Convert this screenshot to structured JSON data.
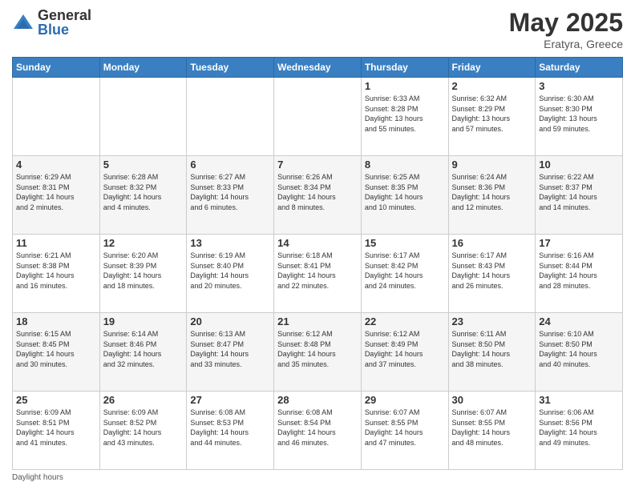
{
  "header": {
    "logo_general": "General",
    "logo_blue": "Blue",
    "month_title": "May 2025",
    "location": "Eratyra, Greece"
  },
  "footer": {
    "daylight_label": "Daylight hours"
  },
  "days_of_week": [
    "Sunday",
    "Monday",
    "Tuesday",
    "Wednesday",
    "Thursday",
    "Friday",
    "Saturday"
  ],
  "weeks": [
    [
      {
        "day": "",
        "info": ""
      },
      {
        "day": "",
        "info": ""
      },
      {
        "day": "",
        "info": ""
      },
      {
        "day": "",
        "info": ""
      },
      {
        "day": "1",
        "info": "Sunrise: 6:33 AM\nSunset: 8:28 PM\nDaylight: 13 hours\nand 55 minutes."
      },
      {
        "day": "2",
        "info": "Sunrise: 6:32 AM\nSunset: 8:29 PM\nDaylight: 13 hours\nand 57 minutes."
      },
      {
        "day": "3",
        "info": "Sunrise: 6:30 AM\nSunset: 8:30 PM\nDaylight: 13 hours\nand 59 minutes."
      }
    ],
    [
      {
        "day": "4",
        "info": "Sunrise: 6:29 AM\nSunset: 8:31 PM\nDaylight: 14 hours\nand 2 minutes."
      },
      {
        "day": "5",
        "info": "Sunrise: 6:28 AM\nSunset: 8:32 PM\nDaylight: 14 hours\nand 4 minutes."
      },
      {
        "day": "6",
        "info": "Sunrise: 6:27 AM\nSunset: 8:33 PM\nDaylight: 14 hours\nand 6 minutes."
      },
      {
        "day": "7",
        "info": "Sunrise: 6:26 AM\nSunset: 8:34 PM\nDaylight: 14 hours\nand 8 minutes."
      },
      {
        "day": "8",
        "info": "Sunrise: 6:25 AM\nSunset: 8:35 PM\nDaylight: 14 hours\nand 10 minutes."
      },
      {
        "day": "9",
        "info": "Sunrise: 6:24 AM\nSunset: 8:36 PM\nDaylight: 14 hours\nand 12 minutes."
      },
      {
        "day": "10",
        "info": "Sunrise: 6:22 AM\nSunset: 8:37 PM\nDaylight: 14 hours\nand 14 minutes."
      }
    ],
    [
      {
        "day": "11",
        "info": "Sunrise: 6:21 AM\nSunset: 8:38 PM\nDaylight: 14 hours\nand 16 minutes."
      },
      {
        "day": "12",
        "info": "Sunrise: 6:20 AM\nSunset: 8:39 PM\nDaylight: 14 hours\nand 18 minutes."
      },
      {
        "day": "13",
        "info": "Sunrise: 6:19 AM\nSunset: 8:40 PM\nDaylight: 14 hours\nand 20 minutes."
      },
      {
        "day": "14",
        "info": "Sunrise: 6:18 AM\nSunset: 8:41 PM\nDaylight: 14 hours\nand 22 minutes."
      },
      {
        "day": "15",
        "info": "Sunrise: 6:17 AM\nSunset: 8:42 PM\nDaylight: 14 hours\nand 24 minutes."
      },
      {
        "day": "16",
        "info": "Sunrise: 6:17 AM\nSunset: 8:43 PM\nDaylight: 14 hours\nand 26 minutes."
      },
      {
        "day": "17",
        "info": "Sunrise: 6:16 AM\nSunset: 8:44 PM\nDaylight: 14 hours\nand 28 minutes."
      }
    ],
    [
      {
        "day": "18",
        "info": "Sunrise: 6:15 AM\nSunset: 8:45 PM\nDaylight: 14 hours\nand 30 minutes."
      },
      {
        "day": "19",
        "info": "Sunrise: 6:14 AM\nSunset: 8:46 PM\nDaylight: 14 hours\nand 32 minutes."
      },
      {
        "day": "20",
        "info": "Sunrise: 6:13 AM\nSunset: 8:47 PM\nDaylight: 14 hours\nand 33 minutes."
      },
      {
        "day": "21",
        "info": "Sunrise: 6:12 AM\nSunset: 8:48 PM\nDaylight: 14 hours\nand 35 minutes."
      },
      {
        "day": "22",
        "info": "Sunrise: 6:12 AM\nSunset: 8:49 PM\nDaylight: 14 hours\nand 37 minutes."
      },
      {
        "day": "23",
        "info": "Sunrise: 6:11 AM\nSunset: 8:50 PM\nDaylight: 14 hours\nand 38 minutes."
      },
      {
        "day": "24",
        "info": "Sunrise: 6:10 AM\nSunset: 8:50 PM\nDaylight: 14 hours\nand 40 minutes."
      }
    ],
    [
      {
        "day": "25",
        "info": "Sunrise: 6:09 AM\nSunset: 8:51 PM\nDaylight: 14 hours\nand 41 minutes."
      },
      {
        "day": "26",
        "info": "Sunrise: 6:09 AM\nSunset: 8:52 PM\nDaylight: 14 hours\nand 43 minutes."
      },
      {
        "day": "27",
        "info": "Sunrise: 6:08 AM\nSunset: 8:53 PM\nDaylight: 14 hours\nand 44 minutes."
      },
      {
        "day": "28",
        "info": "Sunrise: 6:08 AM\nSunset: 8:54 PM\nDaylight: 14 hours\nand 46 minutes."
      },
      {
        "day": "29",
        "info": "Sunrise: 6:07 AM\nSunset: 8:55 PM\nDaylight: 14 hours\nand 47 minutes."
      },
      {
        "day": "30",
        "info": "Sunrise: 6:07 AM\nSunset: 8:55 PM\nDaylight: 14 hours\nand 48 minutes."
      },
      {
        "day": "31",
        "info": "Sunrise: 6:06 AM\nSunset: 8:56 PM\nDaylight: 14 hours\nand 49 minutes."
      }
    ]
  ]
}
